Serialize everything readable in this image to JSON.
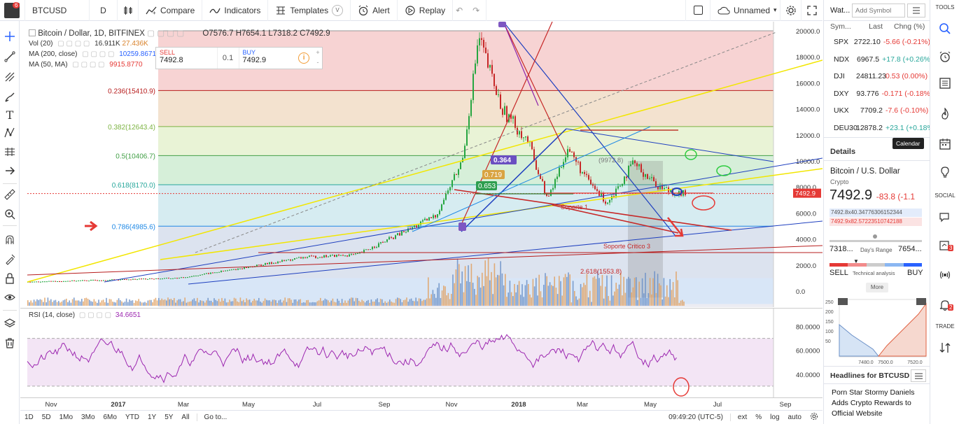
{
  "toolbar": {
    "avatar_badge": "6",
    "symbol": "BTCUSD",
    "interval": "D",
    "compare": "Compare",
    "indicators": "Indicators",
    "templates": "Templates",
    "alert": "Alert",
    "replay": "Replay",
    "layout_name": "Unnamed"
  },
  "chart": {
    "title": "Bitcoin / Dollar, 1D, BITFINEX",
    "ohlc": {
      "o": "O7576.7",
      "h": "H7654.1",
      "l": "L7318.2",
      "c": "C7492.9"
    },
    "indicators": [
      {
        "name": "Vol (20)",
        "v1": "16.911K",
        "v2": "27.436K",
        "c1": "#333",
        "c2": "#d9822b"
      },
      {
        "name": "MA (200, close)",
        "v1": "10259.8671",
        "v2": "",
        "c1": "#2962ff",
        "c2": "#333"
      },
      {
        "name": "MA (50, MA)",
        "v1": "9915.8770",
        "v2": "",
        "c1": "#e53935",
        "c2": "#333"
      }
    ],
    "trade": {
      "sell_label": "SELL",
      "sell_price": "7492.8",
      "spread": "0.1",
      "buy_label": "BUY",
      "buy_price": "7492.9"
    },
    "last_price": "7492.9",
    "y_axis": [
      "20000.0",
      "18000.0",
      "16000.0",
      "14000.0",
      "12000.0",
      "10000.0",
      "8000.0",
      "6000.0",
      "4000.0",
      "2000.0",
      "0.0"
    ],
    "fib_levels": [
      {
        "label": "0.236(15410.9)"
      },
      {
        "label": "0.382(12643.4)"
      },
      {
        "label": "0.5(10406.7)"
      },
      {
        "label": "0.618(8170.0)"
      },
      {
        "label": "0.786(4985.6)"
      }
    ],
    "annotations": [
      "0.364",
      "0.653",
      "0.719",
      "Soporte 1",
      "Soporte Critico 3",
      "2.618(1553.8)",
      "(9972.8)"
    ]
  },
  "rsi": {
    "label": "RSI (14, close)",
    "value": "34.6651",
    "y_axis": [
      "80.0000",
      "60.0000",
      "40.0000"
    ]
  },
  "x_axis": [
    "Nov",
    "2017",
    "Mar",
    "May",
    "Jul",
    "Sep",
    "Nov",
    "2018",
    "Mar",
    "May",
    "Jul",
    "Sep"
  ],
  "bottom": {
    "ranges": [
      "1D",
      "5D",
      "1Mo",
      "3Mo",
      "6Mo",
      "YTD",
      "1Y",
      "5Y",
      "All"
    ],
    "goto": "Go to...",
    "time": "09:49:20 (UTC-5)",
    "ext": "ext",
    "pct": "%",
    "log": "log",
    "auto": "auto"
  },
  "watchlist": {
    "title": "Wat...",
    "add_placeholder": "Add Symbol",
    "headers": {
      "symbol": "Sym...",
      "last": "Last",
      "change": "Chng (%)"
    },
    "rows": [
      {
        "sym": "SPX",
        "last": "2722.10",
        "chg": "-5.66 (-0.21%)",
        "dir": "neg"
      },
      {
        "sym": "NDX",
        "last": "6967.5",
        "chg": "+17.8 (+0.26%",
        "dir": "pos"
      },
      {
        "sym": "DJI",
        "last": "24811.23",
        "chg": "0.53 (0.00%)",
        "dir": "neg"
      },
      {
        "sym": "DXY",
        "last": "93.776",
        "chg": "-0.171 (-0.18%",
        "dir": "neg"
      },
      {
        "sym": "UKX",
        "last": "7709.2",
        "chg": "-7.6 (-0.10%)",
        "dir": "neg"
      },
      {
        "sym": "DEU30",
        "last": "12878.2",
        "chg": "+23.1 (+0.18%",
        "dir": "pos"
      }
    ],
    "details_label": "Details",
    "tooltip": "Calendar",
    "detail": {
      "name": "Bitcoin / U.S. Dollar",
      "type": "Crypto",
      "price": "7492.9",
      "change": "-83.8 (-1.1",
      "bid_ask_1": "7492.8x40.34776306152344",
      "bid_ask_2": "7492.9x82.57223510742188",
      "range_low": "7318...",
      "range_label": "Day's Range",
      "range_high": "7654...",
      "sell": "SELL",
      "analysis": "Technical analysis",
      "buy": "BUY",
      "more": "More",
      "depth_y": [
        "250",
        "200",
        "150",
        "100",
        "50"
      ],
      "depth_x": [
        "7480.0",
        "7500.0",
        "7520.0"
      ]
    },
    "headlines_label": "Headlines for BTCUSD",
    "headline": "Porn Star Stormy Daniels Adds Crypto Rewards to Official Website"
  },
  "rightbar": {
    "tools": "TOOLS",
    "social": "SOCIAL",
    "trade": "TRADE",
    "badges": [
      "3",
      "2"
    ]
  }
}
